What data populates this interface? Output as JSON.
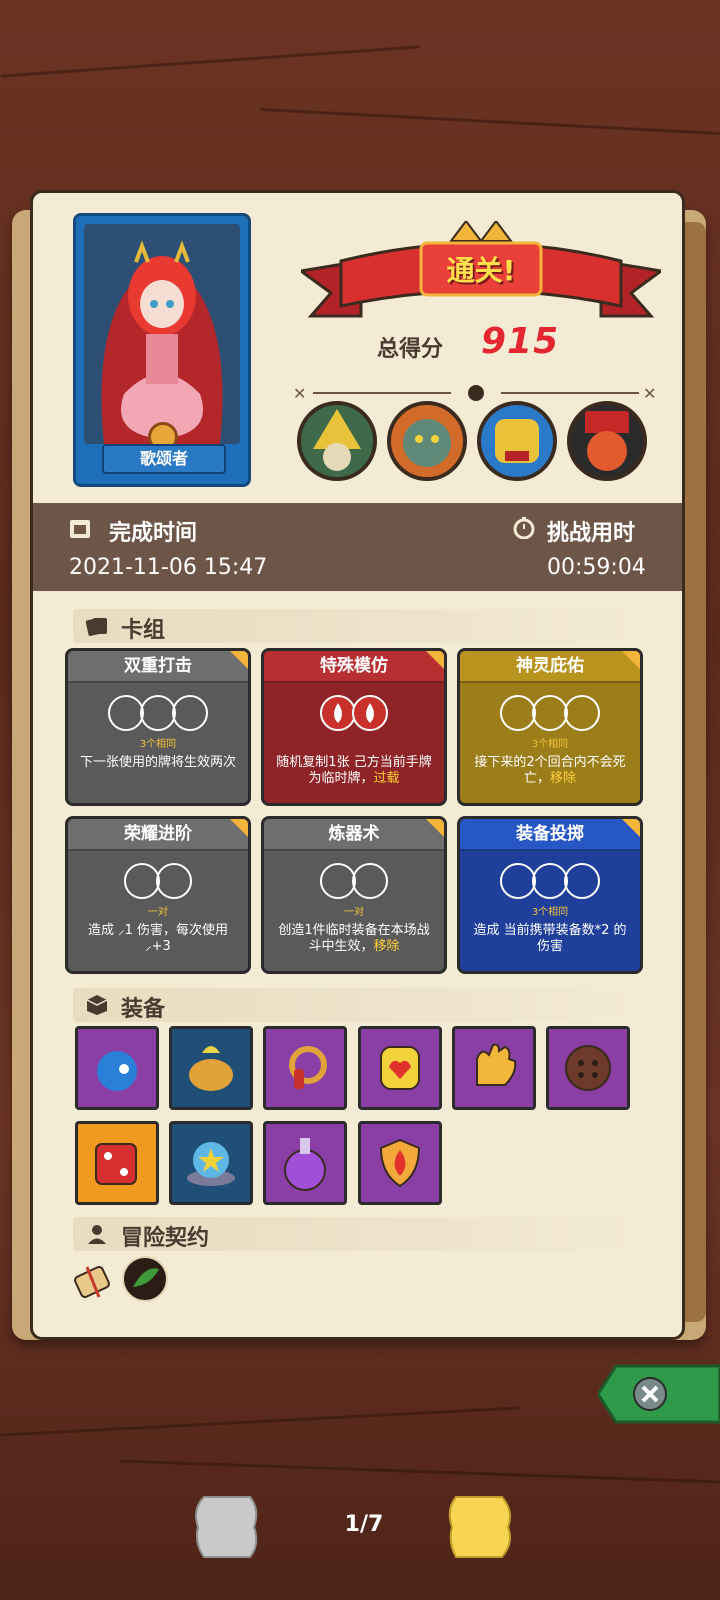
{
  "hero": {
    "name": "歌颂者"
  },
  "result": {
    "banner": "通关!",
    "score_label": "总得分",
    "score_value": "915"
  },
  "time": {
    "completed_label": "完成时间",
    "completed_value": "2021-11-06 15:47",
    "duration_label": "挑战用时",
    "duration_value": "00:59:04"
  },
  "bosses": [
    {
      "icon": "wizard-boss-portrait"
    },
    {
      "icon": "troll-boss-portrait"
    },
    {
      "icon": "mask-boss-portrait"
    },
    {
      "icon": "cook-boss-portrait"
    }
  ],
  "deck": {
    "title": "卡组",
    "cards": [
      {
        "name": "双重打击",
        "tag": "3个相同",
        "color": "#5a5a5a",
        "header": "#6e6e6e",
        "rings": 3,
        "desc": "下一张使用的牌将生效两次",
        "extra": ""
      },
      {
        "name": "特殊模仿",
        "tag": "",
        "color": "#8e2427",
        "header": "#b82f32",
        "rings": 2,
        "desc": "随机复制1张 己方当前手牌 为临时牌，",
        "extra": "过载"
      },
      {
        "name": "神灵庇佑",
        "tag": "3个相同",
        "color": "#9b7d1a",
        "header": "#b8941f",
        "rings": 3,
        "desc": "接下来的2个回合内不会死亡，",
        "extra": "移除"
      },
      {
        "name": "荣耀进阶",
        "tag": "一对",
        "color": "#5a5a5a",
        "header": "#6e6e6e",
        "rings": 2,
        "desc": "造成 ⸝1 伤害，每次使用 ⸝+3",
        "extra": ""
      },
      {
        "name": "炼器术",
        "tag": "一对",
        "color": "#5a5a5a",
        "header": "#6e6e6e",
        "rings": 2,
        "desc": "创造1件临时装备在本场战斗中生效，",
        "extra": "移除"
      },
      {
        "name": "装备投掷",
        "tag": "3个相同",
        "color": "#1f3f9a",
        "header": "#2657c4",
        "rings": 3,
        "desc": "造成 当前携带装备数*2 的伤害",
        "extra": ""
      }
    ]
  },
  "equipment": {
    "title": "装备",
    "items": [
      {
        "icon": "blue-flame-creature-icon",
        "bg": "purple"
      },
      {
        "icon": "golden-pot-icon",
        "bg": "navy"
      },
      {
        "icon": "ring-potion-icon",
        "bg": "purple"
      },
      {
        "icon": "heart-gem-icon",
        "bg": "purple"
      },
      {
        "icon": "glove-icon",
        "bg": "purple"
      },
      {
        "icon": "button-coin-icon",
        "bg": "purple"
      },
      {
        "icon": "red-dice-icon",
        "bg": "orange"
      },
      {
        "icon": "star-orb-icon",
        "bg": "navy"
      },
      {
        "icon": "purple-flask-icon",
        "bg": "purple"
      },
      {
        "icon": "flame-shield-icon",
        "bg": "purple"
      }
    ]
  },
  "contract": {
    "title": "冒险契约",
    "items": [
      {
        "icon": "scroll-icon"
      },
      {
        "icon": "herb-badge-icon"
      }
    ]
  },
  "pager": {
    "text": "1/7"
  }
}
